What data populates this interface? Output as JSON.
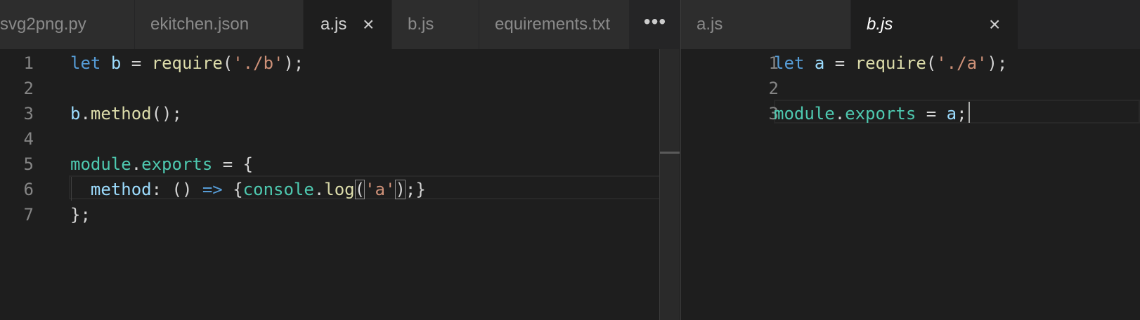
{
  "left_group": {
    "tabs": [
      {
        "label": "svg2png.py",
        "active": false
      },
      {
        "label": "ekitchen.json",
        "active": false
      },
      {
        "label": "a.js",
        "active": true,
        "close_icon": "×"
      },
      {
        "label": "b.js",
        "active": false
      },
      {
        "label": "equirements.txt",
        "active": false
      }
    ],
    "more_label": "•••",
    "lines": [
      {
        "n": "1",
        "tokens": [
          {
            "t": "let",
            "c": "kw"
          },
          {
            "t": " "
          },
          {
            "t": "b",
            "c": "var"
          },
          {
            "t": " = "
          },
          {
            "t": "require",
            "c": "fn"
          },
          {
            "t": "("
          },
          {
            "t": "'./b'",
            "c": "str"
          },
          {
            "t": ");"
          }
        ]
      },
      {
        "n": "2",
        "tokens": []
      },
      {
        "n": "3",
        "tokens": [
          {
            "t": "b",
            "c": "var"
          },
          {
            "t": "."
          },
          {
            "t": "method",
            "c": "fn"
          },
          {
            "t": "();"
          }
        ]
      },
      {
        "n": "4",
        "tokens": []
      },
      {
        "n": "5",
        "tokens": [
          {
            "t": "module",
            "c": "obj"
          },
          {
            "t": "."
          },
          {
            "t": "exports",
            "c": "prop"
          },
          {
            "t": " = {"
          }
        ]
      },
      {
        "n": "6",
        "tokens": [
          {
            "t": "  "
          },
          {
            "t": "method",
            "c": "var"
          },
          {
            "t": ": () "
          },
          {
            "t": "=>",
            "c": "kw"
          },
          {
            "t": " {"
          },
          {
            "t": "console",
            "c": "obj"
          },
          {
            "t": "."
          },
          {
            "t": "log",
            "c": "fn"
          },
          {
            "t": "(",
            "m": true
          },
          {
            "t": "'a'",
            "c": "str"
          },
          {
            "t": ")",
            "m": true
          },
          {
            "t": ";}"
          }
        ]
      },
      {
        "n": "7",
        "tokens": [
          {
            "t": "};"
          }
        ]
      }
    ]
  },
  "right_group": {
    "tabs": [
      {
        "label": "a.js",
        "active": false
      },
      {
        "label": "b.js",
        "active": true,
        "preview": true,
        "close_icon": "×"
      }
    ],
    "lines": [
      {
        "n": "1",
        "tokens": [
          {
            "t": "let",
            "c": "kw"
          },
          {
            "t": " "
          },
          {
            "t": "a",
            "c": "var"
          },
          {
            "t": " = "
          },
          {
            "t": "require",
            "c": "fn"
          },
          {
            "t": "("
          },
          {
            "t": "'./a'",
            "c": "str"
          },
          {
            "t": ");"
          }
        ]
      },
      {
        "n": "2",
        "tokens": []
      },
      {
        "n": "3",
        "tokens": [
          {
            "t": "module",
            "c": "obj"
          },
          {
            "t": "."
          },
          {
            "t": "exports",
            "c": "prop"
          },
          {
            "t": " = "
          },
          {
            "t": "a",
            "c": "var"
          },
          {
            "t": ";"
          }
        ]
      }
    ]
  },
  "colors": {
    "editor_bg": "#1e1e1e",
    "keyword": "#569cd6",
    "variable": "#9cdcfe",
    "function": "#dcdcaa",
    "string": "#ce9178",
    "module": "#4ec9b0"
  },
  "icons": {
    "close": "close-icon",
    "more": "more-actions-icon"
  }
}
